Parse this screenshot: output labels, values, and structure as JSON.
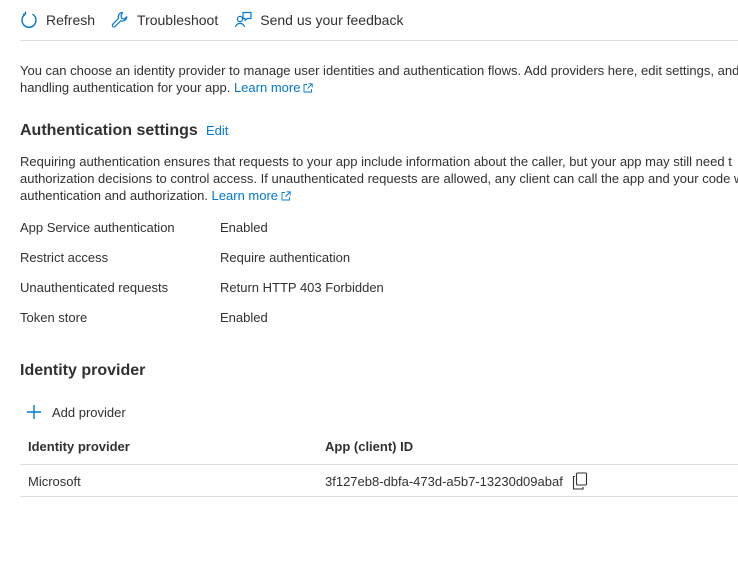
{
  "toolbar": {
    "refresh_label": "Refresh",
    "troubleshoot_label": "Troubleshoot",
    "feedback_label": "Send us your feedback"
  },
  "intro": {
    "line1": "You can choose an identity provider to manage user identities and authentication flows. Add providers here, edit settings, and",
    "line2": "handling authentication for your app.",
    "learn_more": "Learn more"
  },
  "auth_settings": {
    "title": "Authentication settings",
    "edit_label": "Edit",
    "desc_line1": "Requiring authentication ensures that requests to your app include information about the caller, but your app may still need t",
    "desc_line2": "authorization decisions to control access. If unauthenticated requests are allowed, any client can call the app and your code w",
    "desc_line3": "authentication and authorization.",
    "learn_more": "Learn more",
    "rows": [
      {
        "label": "App Service authentication",
        "value": "Enabled"
      },
      {
        "label": "Restrict access",
        "value": "Require authentication"
      },
      {
        "label": "Unauthenticated requests",
        "value": "Return HTTP 403 Forbidden"
      },
      {
        "label": "Token store",
        "value": "Enabled"
      }
    ]
  },
  "identity_provider": {
    "title": "Identity provider",
    "add_label": "Add provider",
    "columns": [
      "Identity provider",
      "App (client) ID"
    ],
    "rows": [
      {
        "provider": "Microsoft",
        "client_id": "3f127eb8-dbfa-473d-a5b7-13230d09abaf"
      }
    ]
  },
  "colors": {
    "accent": "#0078d4",
    "text": "#323130",
    "divider": "#e1dfdd"
  }
}
